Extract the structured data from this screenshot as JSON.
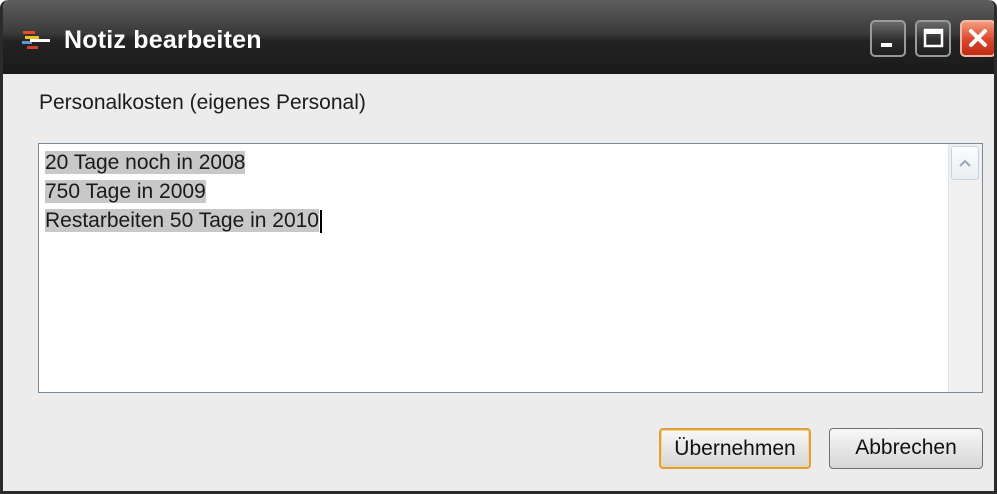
{
  "window": {
    "title": "Notiz bearbeiten",
    "icon": "app-icon",
    "controls": [
      "minimize-icon",
      "maximize-icon",
      "close-icon"
    ],
    "colors": {
      "titlebar": "#2a2a2a",
      "close": "#d9452a",
      "accent_default_button": "#e0a040"
    }
  },
  "form": {
    "label": "Personalkosten (eigenes Personal)",
    "note_lines": [
      "20 Tage noch in 2008",
      "750 Tage in 2009",
      "Restarbeiten 50 Tage in 2010"
    ]
  },
  "buttons": {
    "ok_label": "Übernehmen",
    "cancel_label": "Abbrechen"
  }
}
